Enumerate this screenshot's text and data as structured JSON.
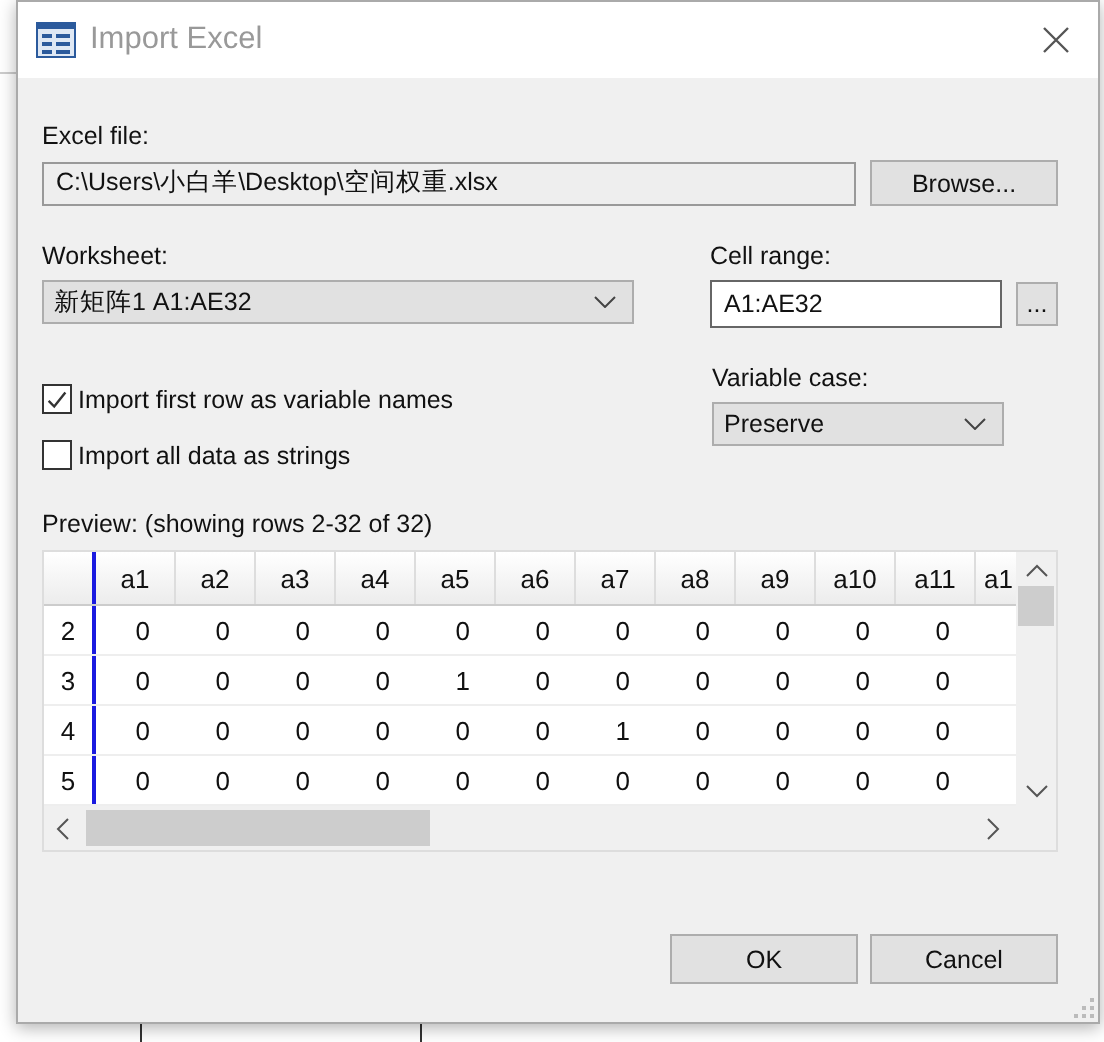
{
  "window": {
    "title": "Import Excel"
  },
  "excel_file": {
    "label": "Excel file:",
    "value": "C:\\Users\\小白羊\\Desktop\\空间权重.xlsx",
    "button": "Browse..."
  },
  "worksheet": {
    "label": "Worksheet:",
    "value": "新矩阵1 A1:AE32"
  },
  "cell_range": {
    "label": "Cell range:",
    "value": "A1:AE32",
    "button": "..."
  },
  "options": [
    {
      "label": "Import first row as variable names",
      "checked": true
    },
    {
      "label": "Import all data as strings",
      "checked": false
    }
  ],
  "variable_case": {
    "label": "Variable case:",
    "value": "Preserve"
  },
  "preview": {
    "label": "Preview: (showing rows 2-32 of 32)",
    "columns": [
      "a1",
      "a2",
      "a3",
      "a4",
      "a5",
      "a6",
      "a7",
      "a8",
      "a9",
      "a10",
      "a11",
      "a1"
    ],
    "rows": [
      {
        "header": "2",
        "cells": [
          "0",
          "0",
          "0",
          "0",
          "0",
          "0",
          "0",
          "0",
          "0",
          "0",
          "0"
        ]
      },
      {
        "header": "3",
        "cells": [
          "0",
          "0",
          "0",
          "0",
          "1",
          "0",
          "0",
          "0",
          "0",
          "0",
          "0"
        ]
      },
      {
        "header": "4",
        "cells": [
          "0",
          "0",
          "0",
          "0",
          "0",
          "0",
          "1",
          "0",
          "0",
          "0",
          "0"
        ]
      },
      {
        "header": "5",
        "cells": [
          "0",
          "0",
          "0",
          "0",
          "0",
          "0",
          "0",
          "0",
          "0",
          "0",
          "0"
        ]
      }
    ]
  },
  "buttons": [
    "OK",
    "Cancel"
  ]
}
